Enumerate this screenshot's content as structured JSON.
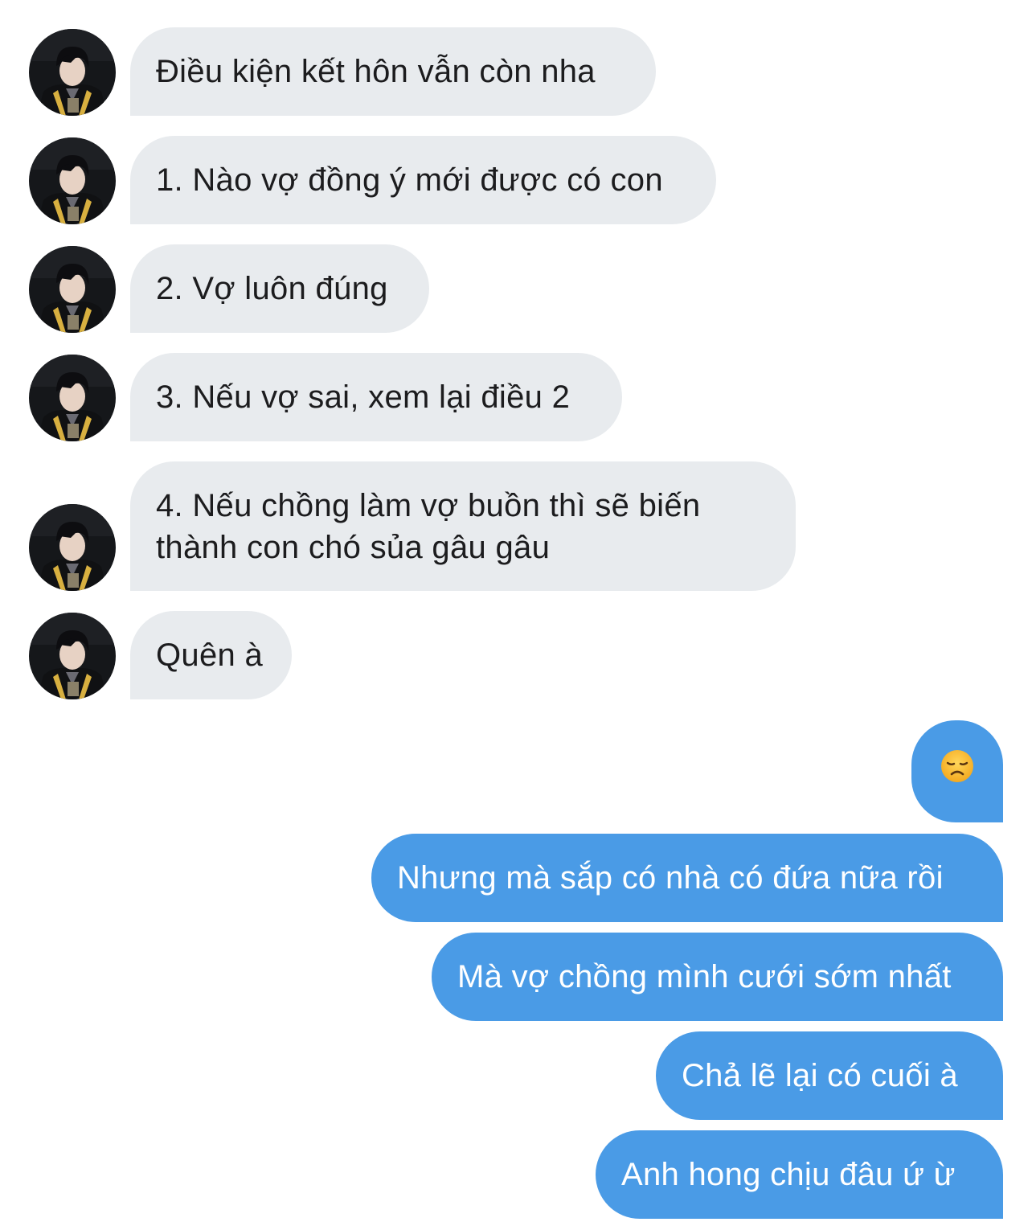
{
  "incoming_messages": [
    {
      "text": "Điều kiện kết hôn vẫn còn nha"
    },
    {
      "text": "1. Nào vợ đồng ý mới được có con"
    },
    {
      "text": "2. Vợ luôn đúng"
    },
    {
      "text": "3. Nếu vợ sai, xem lại điều 2"
    },
    {
      "text": "4. Nếu chồng làm vợ buồn thì sẽ biến thành con chó sủa gâu gâu"
    },
    {
      "text": "Quên à"
    }
  ],
  "outgoing_messages": [
    {
      "emoji": "disappointed-face"
    },
    {
      "text": "Nhưng mà sắp có nhà có đứa nữa rồi"
    },
    {
      "text": "Mà vợ chồng mình cưới sớm nhất"
    },
    {
      "text": "Chả lẽ lại có cuối à"
    },
    {
      "text": "Anh hong chịu đâu ứ ừ"
    }
  ],
  "colors": {
    "incoming_bubble": "#e8ebee",
    "outgoing_bubble": "#4a9be6",
    "incoming_text": "#1c1c1e",
    "outgoing_text": "#ffffff"
  }
}
